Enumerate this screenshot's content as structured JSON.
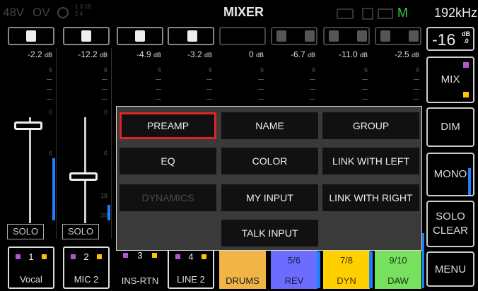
{
  "status_bar": {
    "phantom": "48V",
    "ov": "OV",
    "route_top": "1 3 1B",
    "route_bottom": "2 4",
    "title": "MIXER",
    "indicator_m": "M",
    "sample_rate": "192kHz"
  },
  "channels": [
    {
      "gain": "-2.2",
      "unit": "dB",
      "num": "1",
      "name": "Vocal",
      "solo": "SOLO"
    },
    {
      "gain": "-12.2",
      "unit": "dB",
      "num": "2",
      "name": "MIC 2",
      "solo": "SOLO"
    },
    {
      "gain": "-4.9",
      "unit": "dB",
      "num": "3",
      "name": "INS-RTN"
    },
    {
      "gain": "-3.2",
      "unit": "dB",
      "num": "4",
      "name": "LINE 2"
    },
    {
      "gain": "0",
      "unit": "dB",
      "num": "",
      "name": "DRUMS"
    },
    {
      "gain": "-6.7",
      "unit": "dB",
      "num": "5/6",
      "name": "REV"
    },
    {
      "gain": "-11.0",
      "unit": "dB",
      "num": "7/8",
      "name": "DYN"
    },
    {
      "gain": "-2.5",
      "unit": "dB",
      "num": "9/10",
      "name": "DAW"
    }
  ],
  "scale_marks": [
    "6",
    "0",
    "6",
    "18",
    "30"
  ],
  "channel_colors": {
    "drums": "#f0b447",
    "rev": "#6c6cff",
    "dyn": "#ffd000",
    "daw": "#77e05e",
    "meter": "#1e7fff"
  },
  "right_panel": {
    "level": "-16",
    "level_unit_top": "dB",
    "level_unit_bottom": ".0",
    "mix": "MIX",
    "dim": "DIM",
    "mono": "MONO",
    "solo_clear_1": "SOLO",
    "solo_clear_2": "CLEAR",
    "menu": "MENU"
  },
  "popup_menu": {
    "items": [
      {
        "label": "PREAMP",
        "state": "selected"
      },
      {
        "label": "NAME",
        "state": "enabled"
      },
      {
        "label": "GROUP",
        "state": "enabled"
      },
      {
        "label": "EQ",
        "state": "enabled"
      },
      {
        "label": "COLOR",
        "state": "enabled"
      },
      {
        "label": "LINK WITH LEFT",
        "state": "enabled"
      },
      {
        "label": "DYNAMICS",
        "state": "disabled"
      },
      {
        "label": "MY INPUT",
        "state": "enabled"
      },
      {
        "label": "LINK WITH RIGHT",
        "state": "enabled"
      },
      {
        "label": "TALK INPUT",
        "state": "enabled"
      }
    ]
  }
}
